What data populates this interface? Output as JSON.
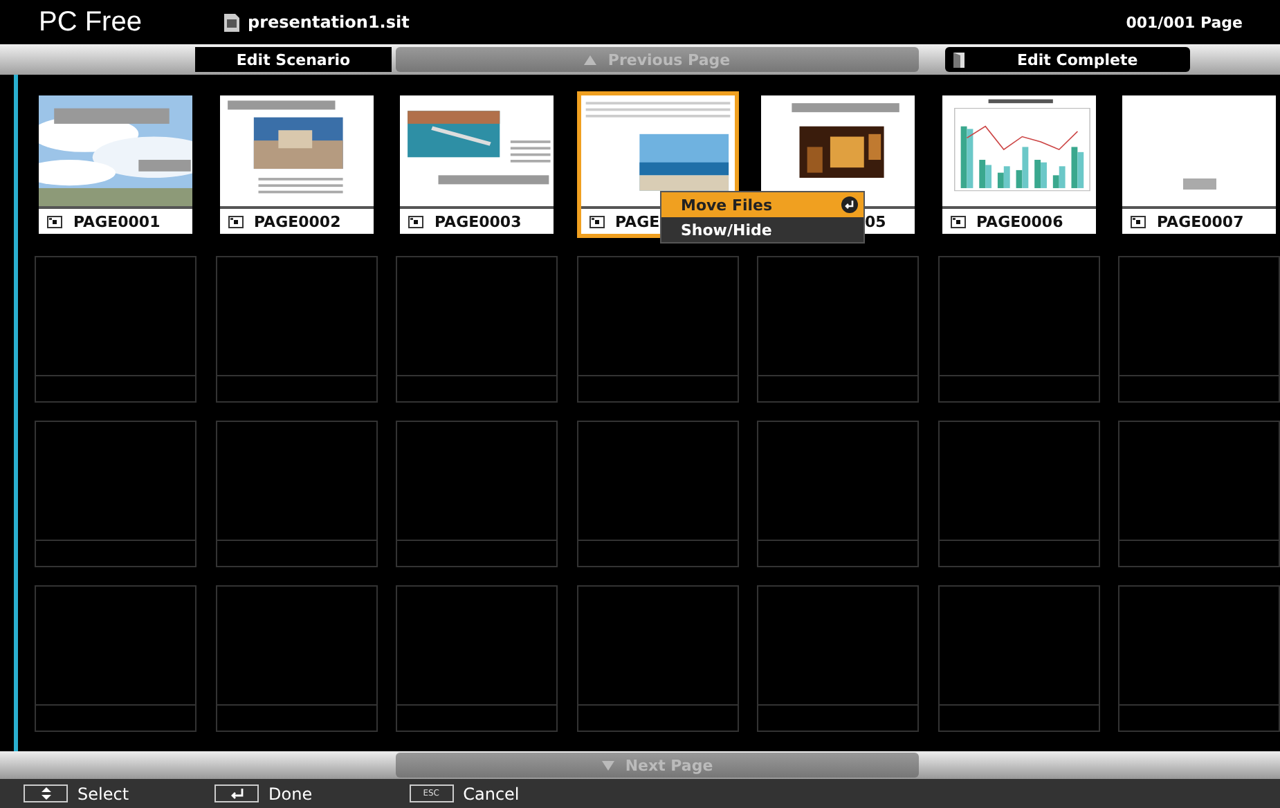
{
  "header": {
    "app_title": "PC Free",
    "file_name": "presentation1.sit",
    "page_count": "001/001 Page"
  },
  "toolbar": {
    "edit_scenario": {
      "label": "Edit Scenario",
      "disabled": false
    },
    "previous_page": {
      "label": "Previous Page",
      "disabled": true
    },
    "edit_complete": {
      "label": "Edit Complete",
      "disabled": false
    }
  },
  "thumbnails": [
    {
      "label": "PAGE0001",
      "kind": "sky",
      "selected": false,
      "icon_covered": false
    },
    {
      "label": "PAGE0002",
      "kind": "town",
      "selected": false,
      "icon_covered": false
    },
    {
      "label": "PAGE0003",
      "kind": "harbor",
      "selected": false,
      "icon_covered": false
    },
    {
      "label": "PAGE",
      "kind": "beach",
      "selected": true,
      "icon_covered": false
    },
    {
      "label": "05",
      "kind": "night",
      "selected": false,
      "icon_covered": true
    },
    {
      "label": "PAGE0006",
      "kind": "chart",
      "selected": false,
      "icon_covered": false
    },
    {
      "label": "PAGE0007",
      "kind": "blank",
      "selected": false,
      "icon_covered": false
    }
  ],
  "context_menu": [
    {
      "label": "Move Files",
      "selected": true
    },
    {
      "label": "Show/Hide",
      "selected": false
    }
  ],
  "next_page": {
    "label": "Next Page",
    "disabled": true
  },
  "footer_hints": [
    {
      "kind": "updown",
      "label": "Select"
    },
    {
      "kind": "enter",
      "label": "Done"
    },
    {
      "kind": "key",
      "key": "ESC",
      "label": "Cancel"
    }
  ]
}
